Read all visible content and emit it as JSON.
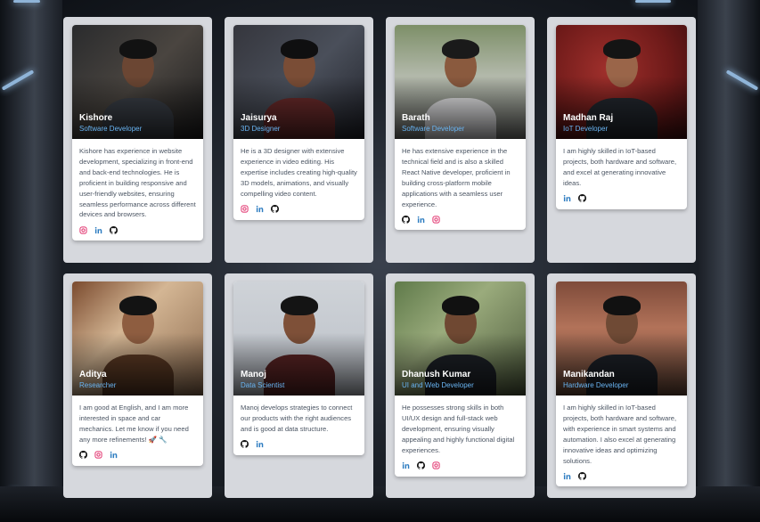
{
  "members": [
    {
      "name": "Kishore",
      "role": "Software Developer",
      "bio": "Kishore has experience in website development, specializing in front-end and back-end technologies. He is proficient in building responsive and user-friendly websites, ensuring seamless performance across different devices and browsers.",
      "socials": [
        "instagram-icon",
        "linkedin-icon",
        "github-icon"
      ]
    },
    {
      "name": "Jaisurya",
      "role": "3D Designer",
      "bio": "He is a 3D designer with extensive experience in video editing. His expertise includes creating high-quality 3D models, animations, and visually compelling video content.",
      "socials": [
        "instagram-icon",
        "linkedin-icon",
        "github-icon"
      ]
    },
    {
      "name": "Barath",
      "role": "Software Developer",
      "bio": "He has extensive experience in the technical field and is also a skilled React Native developer, proficient in building cross-platform mobile applications with a seamless user experience.",
      "socials": [
        "github-icon",
        "linkedin-icon",
        "instagram-icon"
      ]
    },
    {
      "name": "Madhan Raj",
      "role": "IoT Developer",
      "bio": "I am highly skilled in IoT-based projects, both hardware and software, and excel at generating innovative ideas.",
      "socials": [
        "linkedin-icon",
        "github-icon"
      ]
    },
    {
      "name": "Aditya",
      "role": "Researcher",
      "bio": "I am good at English, and I am more interested in space and car mechanics. Let me know if you need any more refinements! 🚀 🔧",
      "socials": [
        "github-icon",
        "instagram-icon",
        "linkedin-icon"
      ]
    },
    {
      "name": "Manoj",
      "role": "Data Scientist",
      "bio": "Manoj develops strategies to connect our products with the right audiences and is good at data structure.",
      "socials": [
        "github-icon",
        "linkedin-icon"
      ]
    },
    {
      "name": "Dhanush Kumar",
      "role": "UI and Web Developer",
      "bio": "He possesses strong skills in both UI/UX design and full-stack web development, ensuring visually appealing and highly functional digital experiences.",
      "socials": [
        "linkedin-icon",
        "github-icon",
        "instagram-icon"
      ]
    },
    {
      "name": "Manikandan",
      "role": "Hardware Developer",
      "bio": "I am highly skilled in IoT-based projects, both hardware and software, with experience in smart systems and automation. I also excel at generating innovative ideas and optimizing solutions.",
      "socials": [
        "linkedin-icon",
        "github-icon"
      ]
    }
  ],
  "colors": {
    "role": "#69b4f2",
    "instagram": "#e1306c",
    "linkedin": "#2b7bc0",
    "github": "#111111",
    "card": "#ffffff",
    "column": "#d6d8dd"
  }
}
